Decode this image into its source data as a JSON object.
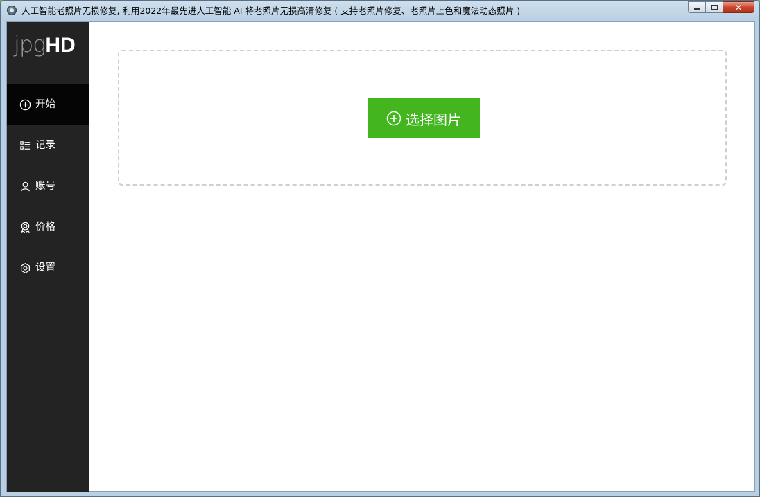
{
  "window": {
    "title": "人工智能老照片无损修复, 利用2022年最先进人工智能 AI 将老照片无损高清修复 ( 支持老照片修复、老照片上色和魔法动态照片 )",
    "close_glyph": "✕"
  },
  "sidebar": {
    "logo_light": "jpg",
    "logo_bold": "HD",
    "items": [
      {
        "label": "开始",
        "icon": "plus-circle-icon",
        "active": true
      },
      {
        "label": "记录",
        "icon": "list-icon",
        "active": false
      },
      {
        "label": "账号",
        "icon": "user-icon",
        "active": false
      },
      {
        "label": "价格",
        "icon": "award-icon",
        "active": false
      },
      {
        "label": "设置",
        "icon": "gear-icon",
        "active": false
      }
    ]
  },
  "main": {
    "select_button_label": "选择图片"
  },
  "colors": {
    "sidebar_bg": "#232323",
    "sidebar_active_bg": "#050505",
    "accent_green": "#43b51f"
  }
}
